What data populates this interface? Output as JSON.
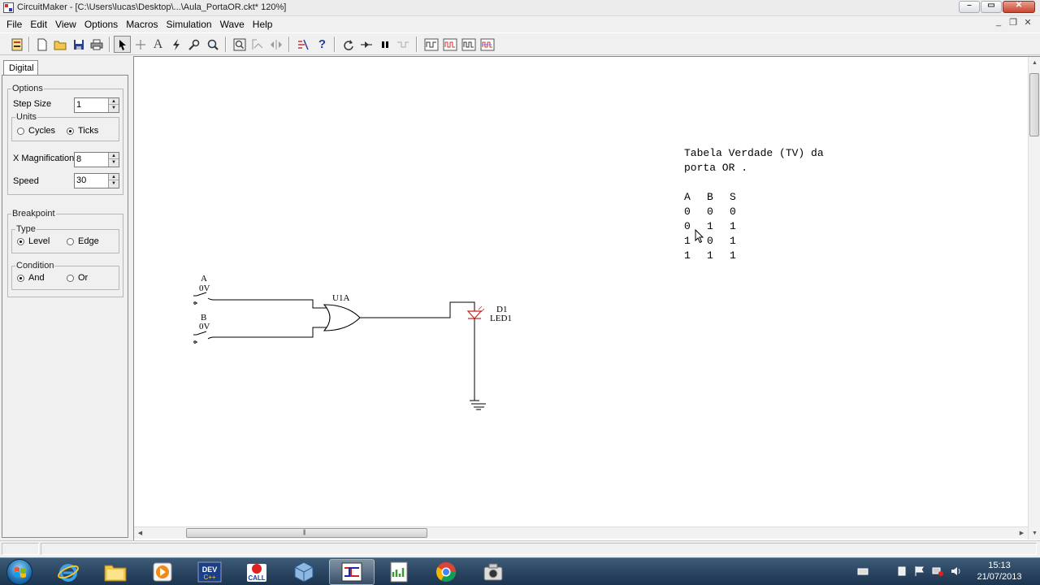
{
  "window": {
    "title": "CircuitMaker - [C:\\Users\\lucas\\Desktop\\...\\Aula_PortaOR.ckt* 120%]",
    "controls": {
      "minimize": "–",
      "restore": "▭",
      "close": "✕"
    }
  },
  "menu": [
    "File",
    "Edit",
    "View",
    "Options",
    "Macros",
    "Simulation",
    "Wave",
    "Help"
  ],
  "toolbar": {
    "icons": [
      "parts-bin-icon",
      "new-file-icon",
      "open-folder-icon",
      "save-icon",
      "print-icon",
      "arrow-select-icon",
      "wire-cross-icon",
      "text-tool-icon",
      "probe-lightning-icon",
      "probe-icon",
      "zoom-icon",
      "zoom-full-icon",
      "zoom-area-icon",
      "pan-icon",
      "digital-analog-icon",
      "help-question-icon",
      "reset-icon",
      "step-icon",
      "pause-icon",
      "trace-icon",
      "waveform-icon-1",
      "waveform-icon-2",
      "waveform-icon-3",
      "waveform-icon-4"
    ]
  },
  "left_panel": {
    "tab": "Digital",
    "options": {
      "group_title": "Options",
      "step_size_label": "Step Size",
      "step_size_value": "1",
      "units_title": "Units",
      "units": [
        {
          "label": "Cycles",
          "selected": false
        },
        {
          "label": "Ticks",
          "selected": true
        }
      ],
      "x_magnification_label": "X Magnification",
      "x_magnification_value": "8",
      "speed_label": "Speed",
      "speed_value": "30"
    },
    "breakpoint": {
      "group_title": "Breakpoint",
      "type_title": "Type",
      "type": [
        {
          "label": "Level",
          "selected": true
        },
        {
          "label": "Edge",
          "selected": false
        }
      ],
      "condition_title": "Condition",
      "condition": [
        {
          "label": "And",
          "selected": true
        },
        {
          "label": "Or",
          "selected": false
        }
      ]
    }
  },
  "circuit": {
    "input_a": {
      "name": "A",
      "value": "0V"
    },
    "input_b": {
      "name": "B",
      "value": "0V"
    },
    "gate": {
      "name": "U1A"
    },
    "led": {
      "ref": "D1",
      "name": "LED1"
    }
  },
  "truth_table": {
    "title_line1": "Tabela Verdade (TV) da",
    "title_line2": "porta OR .",
    "header": [
      "A",
      "B",
      "S"
    ],
    "rows": [
      [
        "0",
        "0",
        "0"
      ],
      [
        "0",
        "1",
        "1"
      ],
      [
        "1",
        "0",
        "1"
      ],
      [
        "1",
        "1",
        "1"
      ]
    ]
  },
  "taskbar": {
    "apps": [
      "windows-explorer-icon",
      "internet-explorer-icon",
      "folder-icon",
      "media-player-icon",
      "dev-cpp-icon",
      "call-icon",
      "virtualbox-icon",
      "circuitmaker-icon",
      "spreadsheet-icon",
      "chrome-icon",
      "camera-icon"
    ],
    "time": "15:13",
    "date": "21/07/2013"
  }
}
